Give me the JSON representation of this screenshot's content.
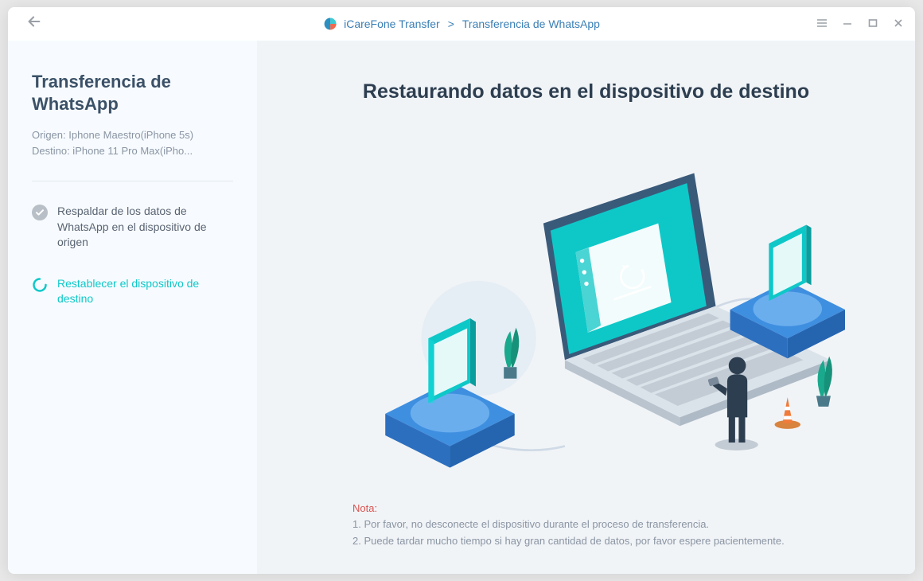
{
  "titlebar": {
    "app_name": "iCareFone Transfer",
    "separator": ">",
    "page_name": "Transferencia de WhatsApp"
  },
  "sidebar": {
    "title": "Transferencia de WhatsApp",
    "origin_label": "Origen: Iphone Maestro(iPhone 5s)",
    "destination_label": "Destino: iPhone 11 Pro Max(iPho...",
    "steps": [
      {
        "label": "Respaldar de los datos de WhatsApp en el dispositivo de origen",
        "status": "done"
      },
      {
        "label": "Restablecer el dispositivo de destino",
        "status": "active"
      }
    ]
  },
  "main": {
    "title": "Restaurando datos en el dispositivo de destino",
    "note_label": "Nota:",
    "note_1": "1. Por favor, no desconecte el dispositivo durante el proceso de transferencia.",
    "note_2": "2. Puede tardar mucho tiempo si hay gran cantidad de datos, por favor espere pacientemente."
  },
  "colors": {
    "accent": "#0ec8c8",
    "sidebar_title": "#3b5167"
  }
}
